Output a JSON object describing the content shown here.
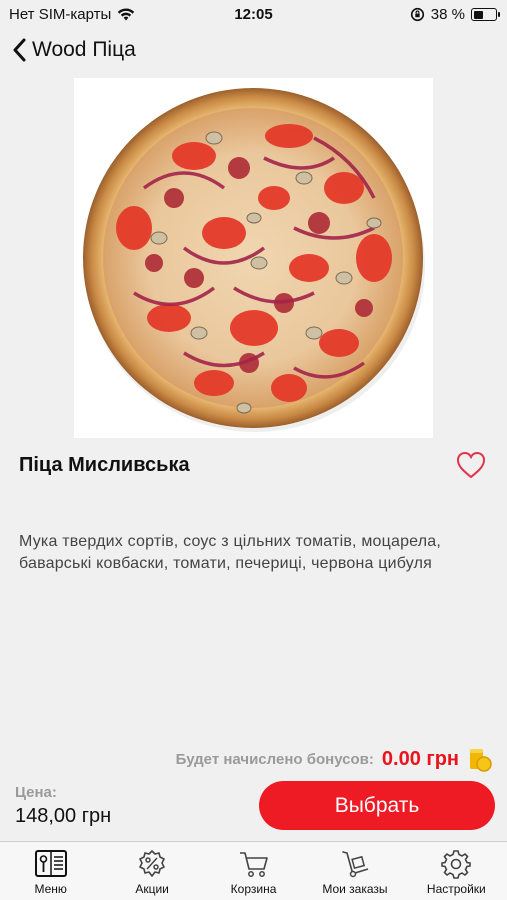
{
  "status_bar": {
    "carrier": "Нет SIM-карты",
    "time": "12:05",
    "battery_percent": "38 %",
    "battery_level": 0.38
  },
  "nav": {
    "back_label": "Wood Піца"
  },
  "product": {
    "title": "Піца Мисливська",
    "description": "Мука твердих сортів, соус з цільних томатів, моцарела, баварські ковбаски, томати, печериці, червона цибуля",
    "price_label": "Цена:",
    "price_value": "148,00 грн",
    "is_favorite": false
  },
  "bonus": {
    "label": "Будет начислено бонусов:",
    "value": "0.00 грн"
  },
  "actions": {
    "select_label": "Выбрать"
  },
  "tab_bar": {
    "items": [
      {
        "label": "Меню",
        "icon": "menu-book-icon"
      },
      {
        "label": "Акции",
        "icon": "percent-badge-icon"
      },
      {
        "label": "Корзина",
        "icon": "cart-icon"
      },
      {
        "label": "Мои заказы",
        "icon": "hand-truck-icon"
      },
      {
        "label": "Настройки",
        "icon": "gear-icon"
      }
    ]
  },
  "colors": {
    "accent": "#ee1b24",
    "bonus_value": "#e9141e",
    "muted_label": "#9a9a9a",
    "background": "#f0f0f0"
  }
}
